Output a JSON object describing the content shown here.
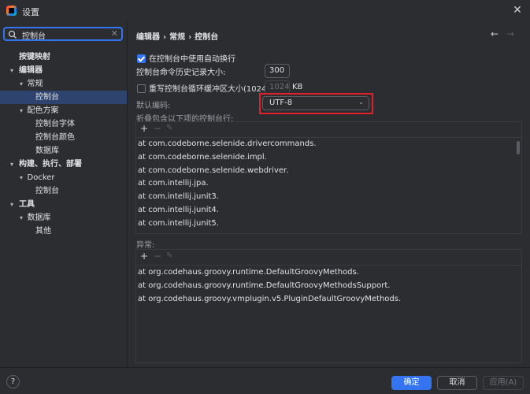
{
  "window": {
    "title": "设置",
    "close_icon": "close-icon"
  },
  "sidebar": {
    "search_value": "控制台",
    "tree": [
      {
        "label": "按键映射",
        "indent": 0,
        "bold": true,
        "chev": ""
      },
      {
        "label": "编辑器",
        "indent": 0,
        "bold": true,
        "chev": "▾"
      },
      {
        "label": "常规",
        "indent": 1,
        "bold": false,
        "chev": "▾"
      },
      {
        "label": "控制台",
        "indent": 2,
        "bold": false,
        "chev": "",
        "selected": true
      },
      {
        "label": "配色方案",
        "indent": 1,
        "bold": false,
        "chev": "▾"
      },
      {
        "label": "控制台字体",
        "indent": 2,
        "bold": false,
        "chev": ""
      },
      {
        "label": "控制台颜色",
        "indent": 2,
        "bold": false,
        "chev": ""
      },
      {
        "label": "数据库",
        "indent": 2,
        "bold": false,
        "chev": ""
      },
      {
        "label": "构建、执行、部署",
        "indent": 0,
        "bold": true,
        "chev": "▾"
      },
      {
        "label": "Docker",
        "indent": 1,
        "bold": false,
        "chev": "▾"
      },
      {
        "label": "控制台",
        "indent": 2,
        "bold": false,
        "chev": ""
      },
      {
        "label": "工具",
        "indent": 0,
        "bold": true,
        "chev": "▾"
      },
      {
        "label": "数据库",
        "indent": 1,
        "bold": false,
        "chev": "▾"
      },
      {
        "label": "其他",
        "indent": 2,
        "bold": false,
        "chev": ""
      }
    ]
  },
  "content": {
    "breadcrumb": [
      "编辑器",
      "常规",
      "控制台"
    ],
    "soft_wrap_label": "在控制台中使用自动换行",
    "soft_wrap_checked": true,
    "history_label": "控制台命令历史记录大小:",
    "history_value": "300",
    "override_buffer_label": "重写控制台循环缓冲区大小(1024 KB)",
    "override_buffer_checked": false,
    "buffer_value": "1024",
    "buffer_unit": "KB",
    "encoding_label": "默认编码:",
    "encoding_value": "UTF-8",
    "fold_label": "折叠包含以下项的控制台行:",
    "fold_rows": [
      "at com.codeborne.selenide.drivercommands.",
      "at com.codeborne.selenide.impl.",
      "at com.codeborne.selenide.webdriver.",
      "at com.intellij.jpa.",
      "at com.intellij.junit3.",
      "at com.intellij.junit4.",
      "at com.intellij.junit5."
    ],
    "exceptions_label": "异常:",
    "exception_rows": [
      "at org.codehaus.groovy.runtime.DefaultGroovyMethods.",
      "at org.codehaus.groovy.runtime.DefaultGroovyMethodsSupport.",
      "at org.codehaus.groovy.vmplugin.v5.PluginDefaultGroovyMethods."
    ]
  },
  "footer": {
    "help_label": "?",
    "ok_label": "确定",
    "cancel_label": "取消",
    "apply_label": "应用(A)"
  },
  "colors": {
    "accent": "#3574f0",
    "highlight_box": "#e0202a",
    "background": "#2b2d30"
  }
}
